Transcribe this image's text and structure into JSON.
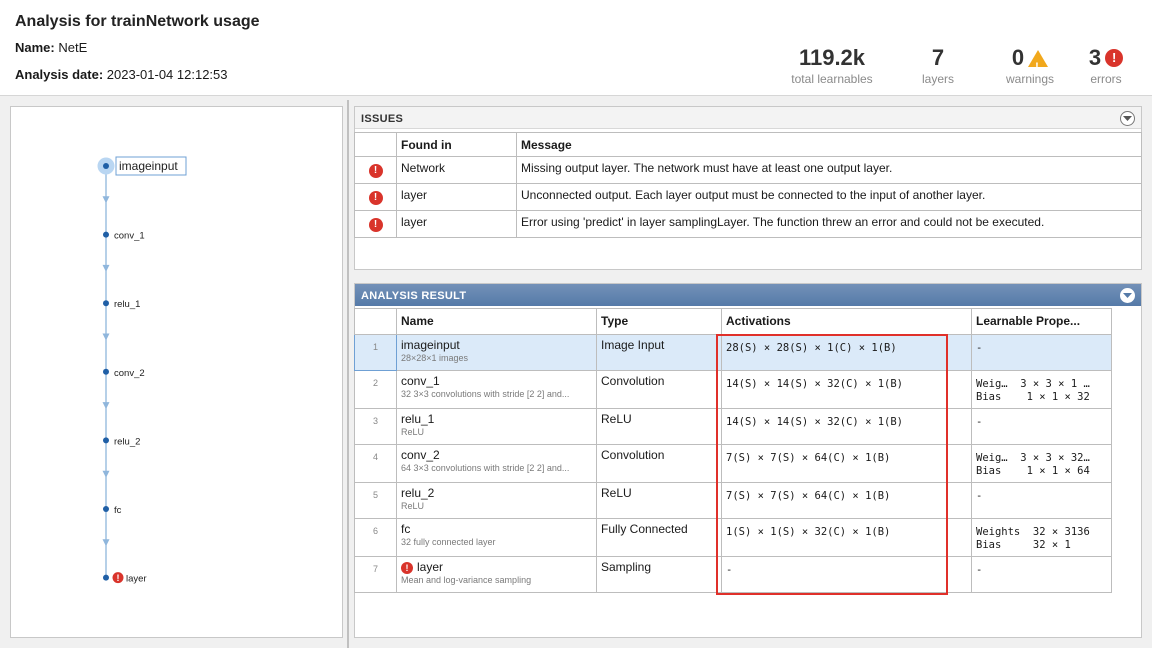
{
  "header": {
    "title": "Analysis for trainNetwork usage",
    "name_label": "Name:",
    "name_value": "NetE",
    "date_label": "Analysis date:",
    "date_value": "2023-01-04 12:12:53"
  },
  "stats": {
    "learnables": {
      "value": "119.2k",
      "label": "total learnables"
    },
    "layers": {
      "value": "7",
      "label": "layers"
    },
    "warnings": {
      "value": "0",
      "label": "warnings"
    },
    "errors": {
      "value": "3",
      "label": "errors"
    }
  },
  "graph": {
    "nodes": [
      {
        "label": "imageinput",
        "selected": true,
        "error": false
      },
      {
        "label": "conv_1",
        "selected": false,
        "error": false
      },
      {
        "label": "relu_1",
        "selected": false,
        "error": false
      },
      {
        "label": "conv_2",
        "selected": false,
        "error": false
      },
      {
        "label": "relu_2",
        "selected": false,
        "error": false
      },
      {
        "label": "fc",
        "selected": false,
        "error": false
      },
      {
        "label": "layer",
        "selected": false,
        "error": true
      }
    ]
  },
  "issues": {
    "title": "ISSUES",
    "columns": {
      "found": "Found in",
      "message": "Message"
    },
    "rows": [
      {
        "icon": "error-icon",
        "found": "Network",
        "message": "Missing output layer. The network must have at least one output layer."
      },
      {
        "icon": "error-icon",
        "found": "layer",
        "message": "Unconnected output. Each layer output must be connected to the input of another layer."
      },
      {
        "icon": "error-icon",
        "found": "layer",
        "message": "Error using 'predict' in layer samplingLayer. The function threw an error and could not be executed."
      }
    ]
  },
  "result": {
    "title": "ANALYSIS RESULT",
    "columns": {
      "name": "Name",
      "type": "Type",
      "activations": "Activations",
      "learnable": "Learnable Prope..."
    },
    "rows": [
      {
        "index": "1",
        "name": "imageinput",
        "desc": "28×28×1 images",
        "type": "Image Input",
        "activations": "28(S) × 28(S) × 1(C) × 1(B)",
        "learn1": "-",
        "learn2": "",
        "error": false
      },
      {
        "index": "2",
        "name": "conv_1",
        "desc": "32 3×3 convolutions with stride [2 2] and...",
        "type": "Convolution",
        "activations": "14(S) × 14(S) × 32(C) × 1(B)",
        "learn1": "Weig…  3 × 3 × 1 …",
        "learn2": "Bias    1 × 1 × 32",
        "error": false
      },
      {
        "index": "3",
        "name": "relu_1",
        "desc": "ReLU",
        "type": "ReLU",
        "activations": "14(S) × 14(S) × 32(C) × 1(B)",
        "learn1": "-",
        "learn2": "",
        "error": false
      },
      {
        "index": "4",
        "name": "conv_2",
        "desc": "64 3×3 convolutions with stride [2 2] and...",
        "type": "Convolution",
        "activations": "7(S) × 7(S) × 64(C) × 1(B)",
        "learn1": "Weig…  3 × 3 × 32…",
        "learn2": "Bias    1 × 1 × 64",
        "error": false
      },
      {
        "index": "5",
        "name": "relu_2",
        "desc": "ReLU",
        "type": "ReLU",
        "activations": "7(S) × 7(S) × 64(C) × 1(B)",
        "learn1": "-",
        "learn2": "",
        "error": false
      },
      {
        "index": "6",
        "name": "fc",
        "desc": "32 fully connected layer",
        "type": "Fully Connected",
        "activations": "1(S) × 1(S) × 32(C) × 1(B)",
        "learn1": "Weights  32 × 3136",
        "learn2": "Bias     32 × 1",
        "error": false
      },
      {
        "index": "7",
        "name": "layer",
        "desc": "Mean and log-variance sampling",
        "type": "Sampling",
        "activations": "-",
        "learn1": "-",
        "learn2": "",
        "error": true
      }
    ]
  },
  "colors": {
    "error": "#d9342b",
    "warning": "#f1a81c",
    "accent": "#5a7eab",
    "selection": "#dbeaf9",
    "highlight": "#e0302a"
  }
}
